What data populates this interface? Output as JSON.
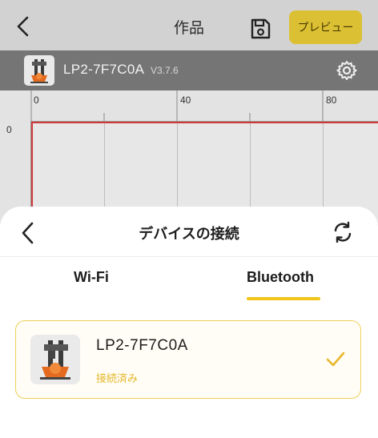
{
  "header": {
    "title": "作品",
    "preview_label": "プレビュー",
    "back_icon": "chevron-left-icon",
    "save_icon": "save-icon"
  },
  "device_bar": {
    "name": "LP2-7F7C0A",
    "version": "V3.7.6",
    "settings_icon": "gear-icon"
  },
  "canvas": {
    "ruler_x_labels": [
      "0",
      "40",
      "80"
    ],
    "ruler_y_labels": [
      "0"
    ],
    "work_area_border_color": "#cf3a3a"
  },
  "sheet": {
    "title": "デバイスの接続",
    "tabs": [
      {
        "label": "Wi-Fi",
        "active": false
      },
      {
        "label": "Bluetooth",
        "active": true
      }
    ],
    "device": {
      "name": "LP2-7F7C0A",
      "status": "接続済み",
      "selected": true
    }
  },
  "colors": {
    "accent": "#f0c419",
    "status": "#e5b72b",
    "preview_button": "#dcc034"
  }
}
